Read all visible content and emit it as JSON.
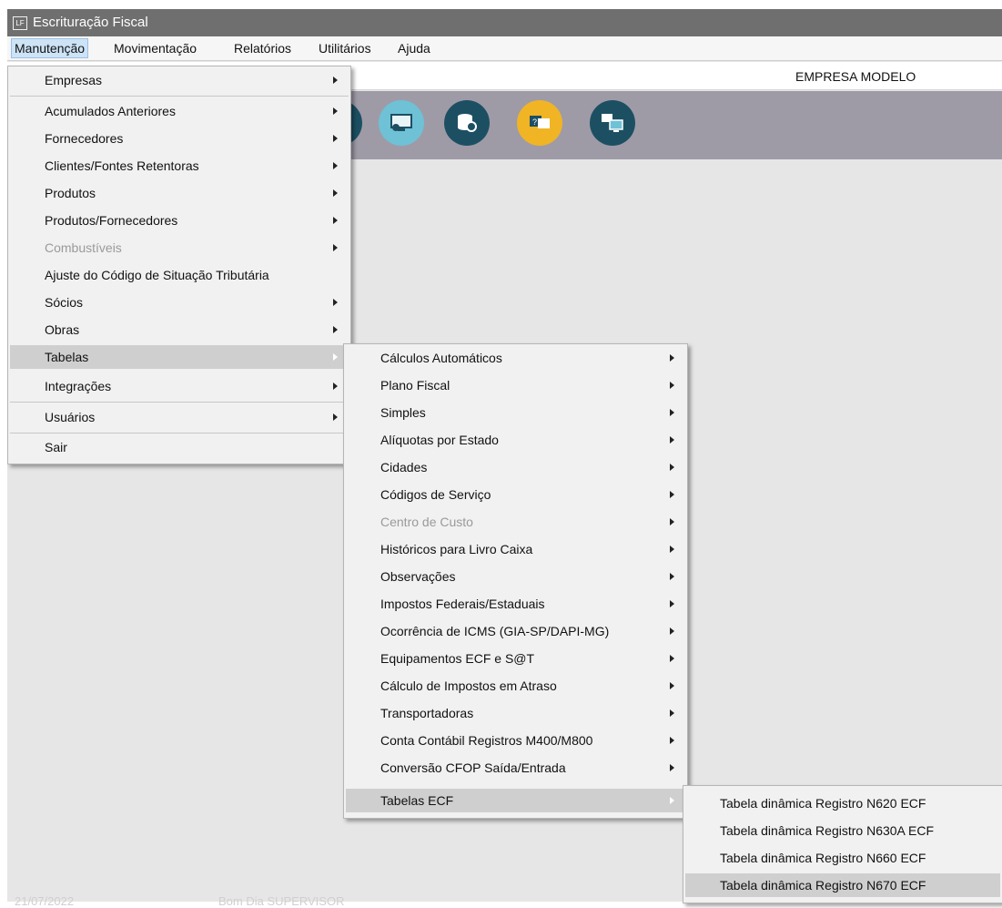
{
  "window": {
    "title": "Escrituração Fiscal",
    "icon": "lf-app-icon"
  },
  "menubar": [
    "Manutenção",
    "Movimentação",
    "Relatórios",
    "Utilitários",
    "Ajuda"
  ],
  "company": "EMPRESA MODELO",
  "toolbar": {
    "buttons": [
      {
        "icon": "monitor-sync-icon",
        "color": "#6fc1d6"
      },
      {
        "icon": "database-refresh-icon",
        "color": "#1d4f63"
      },
      {
        "icon": "help-chat-icon",
        "color": "#f0b425"
      },
      {
        "icon": "network-computers-icon",
        "color": "#1d4f63"
      }
    ]
  },
  "menu_manutencao": {
    "items": [
      {
        "label": "Empresas",
        "submenu": true
      },
      {
        "label": "Acumulados Anteriores",
        "submenu": true
      },
      {
        "label": "Fornecedores",
        "submenu": true
      },
      {
        "label": "Clientes/Fontes Retentoras",
        "submenu": true
      },
      {
        "label": "Produtos",
        "submenu": true
      },
      {
        "label": "Produtos/Fornecedores",
        "submenu": true
      },
      {
        "label": "Combustíveis",
        "submenu": true,
        "disabled": true
      },
      {
        "label": "Ajuste do Código de Situação Tributária",
        "submenu": false
      },
      {
        "label": "Sócios",
        "submenu": true
      },
      {
        "label": "Obras",
        "submenu": true
      },
      {
        "label": "Tabelas",
        "submenu": true,
        "highlighted": true
      },
      {
        "label": "Integrações",
        "submenu": true
      },
      {
        "label": "Usuários",
        "submenu": true
      },
      {
        "label": "Sair",
        "submenu": false
      }
    ]
  },
  "menu_tabelas": {
    "items": [
      {
        "label": "Cálculos Automáticos",
        "submenu": true
      },
      {
        "label": "Plano Fiscal",
        "submenu": true
      },
      {
        "label": "Simples",
        "submenu": true
      },
      {
        "label": "Alíquotas por Estado",
        "submenu": true
      },
      {
        "label": "Cidades",
        "submenu": true
      },
      {
        "label": "Códigos de Serviço",
        "submenu": true
      },
      {
        "label": "Centro de Custo",
        "submenu": true,
        "disabled": true
      },
      {
        "label": "Históricos para Livro Caixa",
        "submenu": true
      },
      {
        "label": "Observações",
        "submenu": true
      },
      {
        "label": "Impostos Federais/Estaduais",
        "submenu": true
      },
      {
        "label": "Ocorrência de ICMS (GIA-SP/DAPI-MG)",
        "submenu": true
      },
      {
        "label": "Equipamentos ECF e S@T",
        "submenu": true
      },
      {
        "label": "Cálculo de Impostos em Atraso",
        "submenu": true
      },
      {
        "label": "Transportadoras",
        "submenu": true
      },
      {
        "label": "Conta Contábil Registros M400/M800",
        "submenu": true
      },
      {
        "label": "Conversão CFOP Saída/Entrada",
        "submenu": true
      },
      {
        "label": "Tabelas ECF",
        "submenu": true,
        "highlighted": true
      }
    ]
  },
  "menu_tabelas_ecf": {
    "items": [
      {
        "label": "Tabela dinâmica Registro N620 ECF"
      },
      {
        "label": "Tabela dinâmica Registro N630A ECF"
      },
      {
        "label": "Tabela dinâmica Registro N660 ECF"
      },
      {
        "label": "Tabela dinâmica Registro N670 ECF",
        "highlighted": true
      }
    ]
  },
  "statusbar": [
    "21/07/2022",
    "Bom Dia SUPERVISOR"
  ]
}
